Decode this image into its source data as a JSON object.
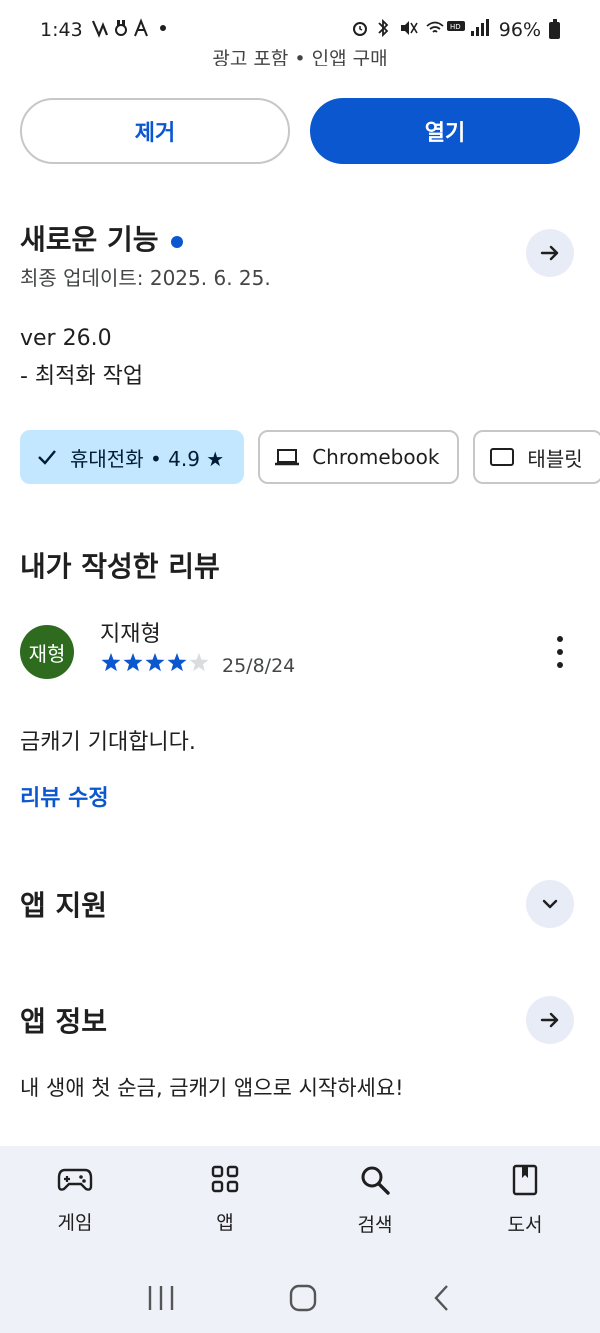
{
  "status_bar": {
    "time": "1:43",
    "battery": "96%",
    "hd_voice": "HD"
  },
  "cut_text": "광고 포함 • 인앱 구매",
  "actions": {
    "remove_label": "제거",
    "open_label": "열기"
  },
  "whats_new": {
    "title": "새로운 기능",
    "updated": "최종 업데이트: 2025. 6. 25.",
    "version": "ver 26.0",
    "notes": "- 최적화 작업"
  },
  "device_chips": [
    {
      "label": "휴대전화 • 4.9 ★",
      "selected": true,
      "icon": "check-icon"
    },
    {
      "label": "Chromebook",
      "selected": false,
      "icon": "laptop-icon"
    },
    {
      "label": "태블릿",
      "selected": false,
      "icon": "tablet-icon"
    }
  ],
  "my_review": {
    "title": "내가 작성한 리뷰",
    "avatar_text": "재형",
    "reviewer": "지재형",
    "rating": 4,
    "rating_max": 5,
    "date": "25/8/24",
    "text": "금캐기 기대합니다.",
    "edit_label": "리뷰 수정"
  },
  "app_support": {
    "title": "앱 지원"
  },
  "app_info": {
    "title": "앱 정보",
    "description": "내 생애 첫 순금, 금캐기 앱으로 시작하세요!"
  },
  "bottom_nav": {
    "items": [
      {
        "label": "게임",
        "icon": "gamepad-icon"
      },
      {
        "label": "앱",
        "icon": "apps-grid-icon"
      },
      {
        "label": "검색",
        "icon": "search-icon"
      },
      {
        "label": "도서",
        "icon": "book-icon"
      }
    ]
  },
  "colors": {
    "accent": "#0b57d0",
    "chip_selected": "#c2e7ff",
    "avatar": "#2e6b1f",
    "nav_bg": "#eef1f8"
  }
}
